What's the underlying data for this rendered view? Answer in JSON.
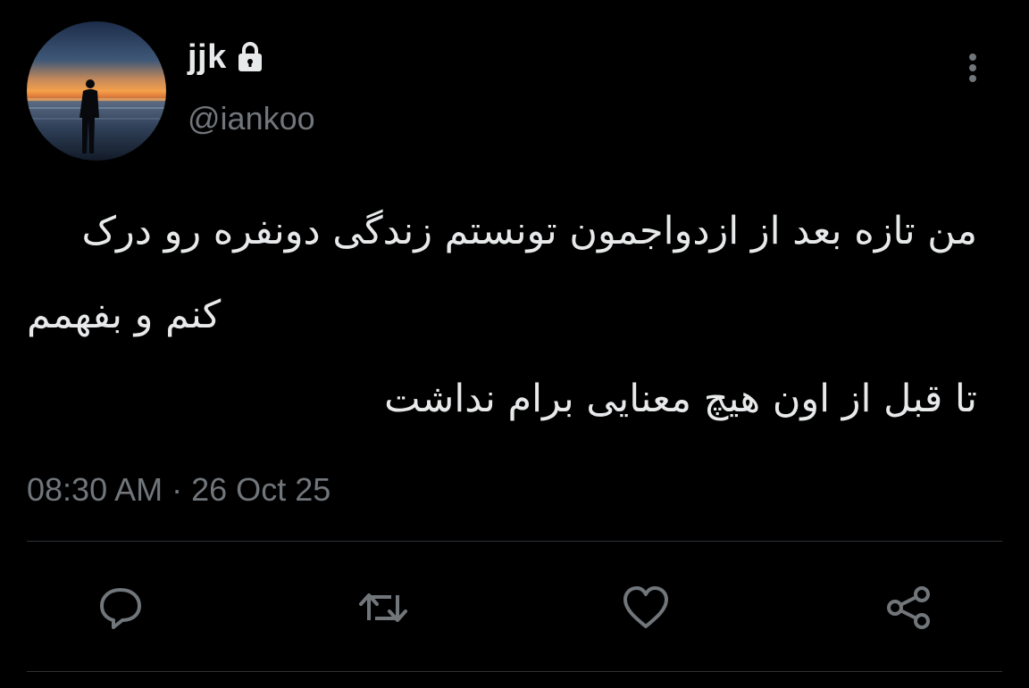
{
  "user": {
    "display_name": "jjk",
    "handle": "@iankoo",
    "protected_icon": "lock-icon",
    "avatar": "silhouette-at-sunset-beach"
  },
  "tweet": {
    "lines": [
      "من تازه بعد از ازدواجمون تونستم زندگی دونفره رو درک",
      "کنم و بفهمم",
      "تا قبل از اون هیچ معنایی برام نداشت"
    ],
    "time": "08:30 AM",
    "separator": "·",
    "date": "26 Oct 25"
  },
  "actions": {
    "reply_icon": "reply-icon",
    "retweet_icon": "retweet-icon",
    "like_icon": "heart-icon",
    "share_icon": "share-icon"
  },
  "colors": {
    "background": "#000000",
    "text_primary": "#e7e9ea",
    "text_secondary": "#71767b",
    "divider": "#2f3336"
  }
}
